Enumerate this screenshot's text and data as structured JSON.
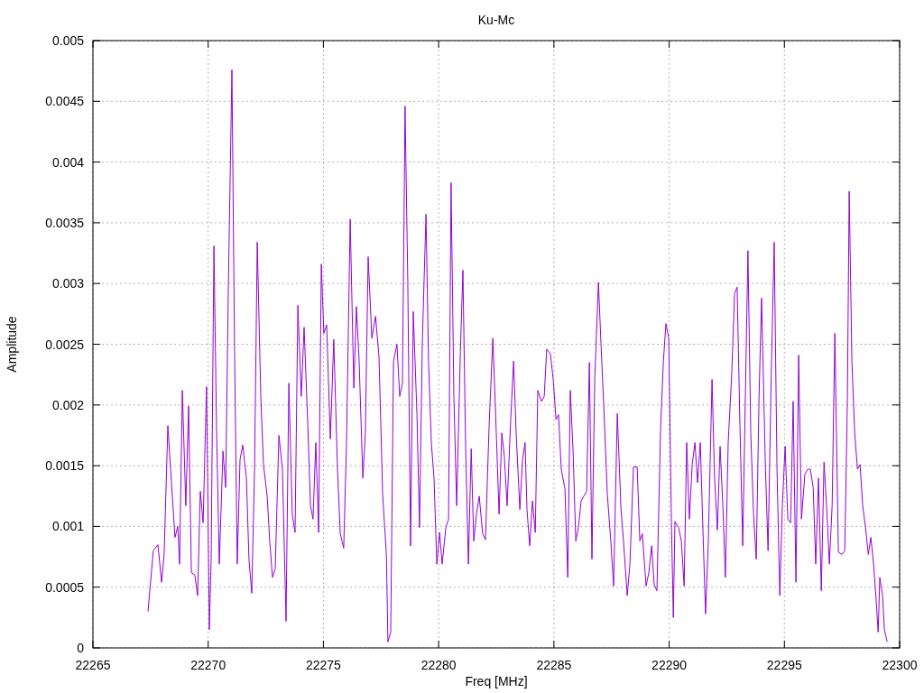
{
  "chart_data": {
    "type": "line",
    "title": "Ku-Mc",
    "xlabel": "Freq [MHz]",
    "ylabel": "Amplitude",
    "grid": true,
    "xlim": [
      22265,
      22300
    ],
    "ylim": [
      0,
      0.005
    ],
    "xticks": [
      22265,
      22270,
      22275,
      22280,
      22285,
      22290,
      22295,
      22300
    ],
    "yticks": [
      {
        "value": 0,
        "label": "0"
      },
      {
        "value": 0.0005,
        "label": "0.0005"
      },
      {
        "value": 0.001,
        "label": "0.001"
      },
      {
        "value": 0.0015,
        "label": "0.0015"
      },
      {
        "value": 0.002,
        "label": "0.002"
      },
      {
        "value": 0.0025,
        "label": "0.0025"
      },
      {
        "value": 0.003,
        "label": "0.003"
      },
      {
        "value": 0.0035,
        "label": "0.0035"
      },
      {
        "value": 0.004,
        "label": "0.004"
      },
      {
        "value": 0.0045,
        "label": "0.0045"
      },
      {
        "value": 0.005,
        "label": "0.005"
      }
    ],
    "x": [
      22267.39,
      22267.62,
      22267.82,
      22267.98,
      22268.09,
      22268.25,
      22268.56,
      22268.68,
      22268.76,
      22268.88,
      22269.03,
      22269.15,
      22269.27,
      22269.42,
      22269.54,
      22269.66,
      22269.78,
      22269.93,
      22270.05,
      22270.13,
      22270.25,
      22270.36,
      22270.48,
      22270.64,
      22270.76,
      22270.87,
      22271.03,
      22271.15,
      22271.26,
      22271.38,
      22271.5,
      22271.66,
      22271.77,
      22271.89,
      22272.01,
      22272.13,
      22272.28,
      22272.4,
      22272.56,
      22272.67,
      22272.79,
      22272.91,
      22273.07,
      22273.22,
      22273.38,
      22273.5,
      22273.65,
      22273.77,
      22273.89,
      22274.04,
      22274.16,
      22274.32,
      22274.44,
      22274.55,
      22274.67,
      22274.79,
      22274.91,
      22275.02,
      22275.14,
      22275.3,
      22275.45,
      22275.61,
      22275.73,
      22275.88,
      22276.0,
      22276.16,
      22276.32,
      22276.43,
      22276.55,
      22276.71,
      22276.82,
      22276.94,
      22277.1,
      22277.26,
      22277.41,
      22277.57,
      22277.73,
      22277.8,
      22277.92,
      22278.04,
      22278.19,
      22278.31,
      22278.43,
      22278.54,
      22278.66,
      22278.78,
      22278.9,
      22279.06,
      22279.17,
      22279.29,
      22279.45,
      22279.56,
      22279.68,
      22279.8,
      22279.92,
      22280.04,
      22280.15,
      22280.31,
      22280.43,
      22280.54,
      22280.66,
      22280.78,
      22280.94,
      22281.05,
      22281.17,
      22281.29,
      22281.41,
      22281.52,
      22281.64,
      22281.76,
      22281.91,
      22282.03,
      22282.19,
      22282.35,
      22282.5,
      22282.62,
      22282.74,
      22282.85,
      22282.97,
      22283.13,
      22283.25,
      22283.36,
      22283.52,
      22283.64,
      22283.75,
      22283.83,
      22283.95,
      22284.07,
      22284.19,
      22284.3,
      22284.46,
      22284.58,
      22284.69,
      22284.85,
      22284.97,
      22285.09,
      22285.2,
      22285.32,
      22285.48,
      22285.6,
      22285.71,
      22285.83,
      22285.95,
      22286.07,
      22286.18,
      22286.3,
      22286.42,
      22286.54,
      22286.65,
      22286.77,
      22286.93,
      22287.04,
      22287.16,
      22287.32,
      22287.47,
      22287.59,
      22287.75,
      22287.91,
      22288.02,
      22288.18,
      22288.3,
      22288.45,
      22288.61,
      22288.73,
      22288.84,
      22289.0,
      22289.12,
      22289.24,
      22289.35,
      22289.47,
      22289.63,
      22289.75,
      22289.86,
      22289.98,
      22290.1,
      22290.18,
      22290.25,
      22290.41,
      22290.53,
      22290.65,
      22290.76,
      22290.88,
      22291.0,
      22291.12,
      22291.23,
      22291.35,
      22291.47,
      22291.58,
      22291.7,
      22291.86,
      22291.97,
      22292.09,
      22292.21,
      22292.33,
      22292.44,
      22292.56,
      22292.72,
      22292.84,
      22292.95,
      22293.07,
      22293.19,
      22293.31,
      22293.42,
      22293.54,
      22293.66,
      22293.78,
      22293.9,
      22294.01,
      22294.17,
      22294.29,
      22294.44,
      22294.56,
      22294.68,
      22294.8,
      22294.91,
      22295.03,
      22295.15,
      22295.27,
      22295.38,
      22295.5,
      22295.62,
      22295.74,
      22295.89,
      22296.01,
      22296.13,
      22296.25,
      22296.36,
      22296.48,
      22296.6,
      22296.72,
      22296.83,
      22296.95,
      22297.07,
      22297.19,
      22297.34,
      22297.5,
      22297.62,
      22297.73,
      22297.81,
      22297.93,
      22298.05,
      22298.17,
      22298.28,
      22298.4,
      22298.52,
      22298.64,
      22298.75,
      22298.87,
      22298.99,
      22299.07,
      22299.14,
      22299.26,
      22299.34,
      22299.46
    ],
    "series": [
      {
        "color": "#9400d3",
        "values": [
          0.0003,
          0.0008,
          0.00085,
          0.00054,
          0.00077,
          0.00183,
          0.00091,
          0.001,
          0.00069,
          0.00212,
          0.00117,
          0.00199,
          0.00062,
          0.0006,
          0.00043,
          0.00129,
          0.00103,
          0.00215,
          0.00015,
          0.00073,
          0.00331,
          0.00184,
          0.00069,
          0.00162,
          0.00132,
          0.00288,
          0.00476,
          0.00236,
          0.00069,
          0.00155,
          0.00167,
          0.0014,
          0.00073,
          0.00045,
          0.00147,
          0.00334,
          0.00207,
          0.00151,
          0.00125,
          0.00088,
          0.00058,
          0.00065,
          0.00175,
          0.00147,
          0.00022,
          0.00218,
          0.0011,
          0.00095,
          0.00282,
          0.00207,
          0.00264,
          0.00184,
          0.00117,
          0.00106,
          0.00169,
          0.00095,
          0.00316,
          0.00259,
          0.00266,
          0.00172,
          0.00254,
          0.00147,
          0.00094,
          0.00082,
          0.00169,
          0.00353,
          0.00214,
          0.00281,
          0.00236,
          0.0014,
          0.00177,
          0.00322,
          0.00255,
          0.00273,
          0.0024,
          0.00126,
          0.00077,
          5e-05,
          0.00013,
          0.00236,
          0.0025,
          0.00207,
          0.00218,
          0.00446,
          0.00303,
          0.00084,
          0.00277,
          0.00192,
          0.00099,
          0.00251,
          0.00357,
          0.00236,
          0.00169,
          0.0014,
          0.00069,
          0.00095,
          0.00069,
          0.00099,
          0.00106,
          0.00383,
          0.00207,
          0.00117,
          0.00244,
          0.00311,
          0.00166,
          0.00069,
          0.00164,
          0.00088,
          0.0011,
          0.00125,
          0.00094,
          0.00089,
          0.00184,
          0.00255,
          0.00177,
          0.0011,
          0.00177,
          0.00158,
          0.00117,
          0.0019,
          0.00236,
          0.00177,
          0.00114,
          0.00155,
          0.00169,
          0.00114,
          0.00084,
          0.00121,
          0.00095,
          0.00212,
          0.00203,
          0.00207,
          0.00246,
          0.00242,
          0.00221,
          0.00188,
          0.00192,
          0.00147,
          0.00131,
          0.00058,
          0.00212,
          0.00162,
          0.00088,
          0.001,
          0.00121,
          0.00125,
          0.00129,
          0.00235,
          0.00073,
          0.00221,
          0.00301,
          0.00251,
          0.00201,
          0.00126,
          0.00088,
          0.00051,
          0.00193,
          0.00114,
          0.00088,
          0.00043,
          0.00069,
          0.00149,
          0.00149,
          0.00088,
          0.00094,
          0.00051,
          0.00062,
          0.00084,
          0.00052,
          0.00047,
          0.00181,
          0.00236,
          0.00267,
          0.00255,
          0.00103,
          0.00025,
          0.00104,
          0.00099,
          0.00088,
          0.00051,
          0.00169,
          0.00106,
          0.00151,
          0.00169,
          0.00136,
          0.00169,
          0.00095,
          0.00028,
          0.00088,
          0.00221,
          0.0014,
          0.00097,
          0.00166,
          0.00117,
          0.00058,
          0.00169,
          0.00227,
          0.00292,
          0.00297,
          0.00184,
          0.00084,
          0.0021,
          0.00327,
          0.00177,
          0.0011,
          0.00073,
          0.00207,
          0.00288,
          0.00153,
          0.0008,
          0.00236,
          0.00334,
          0.00147,
          0.00043,
          0.00117,
          0.00166,
          0.00106,
          0.00103,
          0.00203,
          0.00054,
          0.00241,
          0.00106,
          0.00143,
          0.00147,
          0.00147,
          0.00132,
          0.00069,
          0.0014,
          0.00047,
          0.00153,
          0.00117,
          0.00069,
          0.00117,
          0.00259,
          0.00079,
          0.00077,
          0.0008,
          0.00199,
          0.00376,
          0.00236,
          0.00177,
          0.00147,
          0.00151,
          0.00117,
          0.00099,
          0.00077,
          0.00091,
          0.00069,
          0.00037,
          0.00013,
          0.00058,
          0.00043,
          0.00015,
          5e-05
        ]
      }
    ]
  }
}
